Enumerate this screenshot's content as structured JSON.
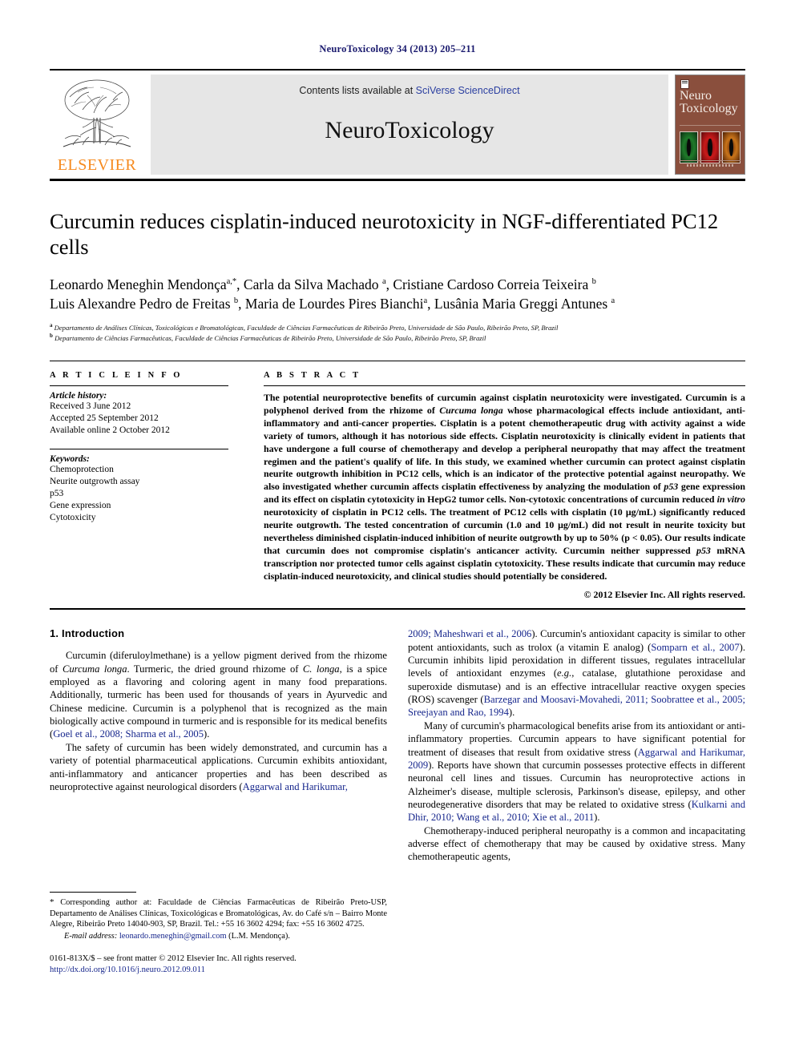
{
  "running_head": "NeuroToxicology 34 (2013) 205–211",
  "masthead": {
    "publisher_name": "ELSEVIER",
    "contents_prefix": "Contents lists available at ",
    "contents_link": "SciVerse ScienceDirect",
    "journal_name": "NeuroToxicology",
    "cover_title_line1": "Neuro",
    "cover_title_line2": "Toxicology"
  },
  "article": {
    "title": "Curcumin reduces cisplatin-induced neurotoxicity in NGF-differentiated PC12 cells",
    "authors_line1": "Leonardo Meneghin Mendonça",
    "authors_line1_sup": "a,*",
    "authors_line1b": ", Carla da Silva Machado ",
    "authors_line1b_sup": "a",
    "authors_line1c": ", Cristiane Cardoso Correia Teixeira ",
    "authors_line1c_sup": "b",
    "authors_line2": "Luis Alexandre Pedro de Freitas ",
    "authors_line2_sup": "b",
    "authors_line2b": ", Maria de Lourdes Pires Bianchi",
    "authors_line2b_sup": "a",
    "authors_line2c": ", Lusânia Maria Greggi Antunes ",
    "authors_line2c_sup": "a",
    "affiliation_a": "Departamento de Análises Clínicas, Toxicológicas e Bromatológicas, Faculdade de Ciências Farmacêuticas de Ribeirão Preto, Universidade de São Paulo, Ribeirão Preto, SP, Brazil",
    "affiliation_b": "Departamento de Ciências Farmacêuticas, Faculdade de Ciências Farmacêuticas de Ribeirão Preto, Universidade de São Paulo, Ribeirão Preto, SP, Brazil"
  },
  "article_info": {
    "label": "A R T I C L E  I N F O",
    "history_title": "Article history:",
    "received": "Received 3 June 2012",
    "accepted": "Accepted 25 September 2012",
    "available": "Available online 2 October 2012",
    "keywords_title": "Keywords:",
    "keywords": [
      "Chemoprotection",
      "Neurite outgrowth assay",
      "p53",
      "Gene expression",
      "Cytotoxicity"
    ]
  },
  "abstract": {
    "label": "A B S T R A C T",
    "part1": "The potential neuroprotective benefits of curcumin against cisplatin neurotoxicity were investigated. Curcumin is a polyphenol derived from the rhizome of ",
    "italic1": "Curcuma longa",
    "part2": " whose pharmacological effects include antioxidant, anti-inflammatory and anti-cancer properties. Cisplatin is a potent chemotherapeutic drug with activity against a wide variety of tumors, although it has notorious side effects. Cisplatin neurotoxicity is clinically evident in patients that have undergone a full course of chemotherapy and develop a peripheral neuropathy that may affect the treatment regimen and the patient's qualify of life. In this study, we examined whether curcumin can protect against cisplatin neurite outgrowth inhibition in PC12 cells, which is an indicator of the protective potential against neuropathy. We also investigated whether curcumin affects cisplatin effectiveness by analyzing the modulation of ",
    "italic2": "p53",
    "part3": " gene expression and its effect on cisplatin cytotoxicity in HepG2 tumor cells. Non-cytotoxic concentrations of curcumin reduced ",
    "italic3": "in vitro",
    "part4": " neurotoxicity of cisplatin in PC12 cells. The treatment of PC12 cells with cisplatin (10 μg/mL) significantly reduced neurite outgrowth. The tested concentration of curcumin (1.0 and 10 μg/mL) did not result in neurite toxicity but nevertheless diminished cisplatin-induced inhibition of neurite outgrowth by up to 50% (p < 0.05). Our results indicate that curcumin does not compromise cisplatin's anticancer activity. Curcumin neither suppressed ",
    "italic4": "p53",
    "part5": " mRNA transcription nor protected tumor cells against cisplatin cytotoxicity. These results indicate that curcumin may reduce cisplatin-induced neurotoxicity, and clinical studies should potentially be considered.",
    "copyright": "© 2012 Elsevier Inc. All rights reserved."
  },
  "introduction": {
    "heading": "1. Introduction",
    "left_p1_a": "Curcumin (diferuloylmethane) is a yellow pigment derived from the rhizome of ",
    "left_p1_i1": "Curcuma longa",
    "left_p1_b": ". Turmeric, the dried ground rhizome of ",
    "left_p1_i2": "C. longa",
    "left_p1_c": ", is a spice employed as a flavoring and coloring agent in many food preparations. Additionally, turmeric has been used for thousands of years in Ayurvedic and Chinese medicine. Curcumin is a polyphenol that is recognized as the main biologically active compound in turmeric and is responsible for its medical benefits (",
    "left_p1_cite": "Goel et al., 2008; Sharma et al., 2005",
    "left_p1_d": ").",
    "left_p2_a": "The safety of curcumin has been widely demonstrated, and curcumin has a variety of potential pharmaceutical applications. Curcumin exhibits antioxidant, anti-inflammatory and anticancer properties and has been described as neuroprotective against neurological disorders (",
    "left_p2_cite": "Aggarwal and Harikumar,",
    "right_p1_cite1": "2009; Maheshwari et al., 2006",
    "right_p1_a": "). Curcumin's antioxidant capacity is similar to other potent antioxidants, such as trolox (a vitamin E analog) (",
    "right_p1_cite2": "Somparn et al., 2007",
    "right_p1_b": "). Curcumin inhibits lipid peroxidation in different tissues, regulates intracellular levels of antioxidant enzymes (",
    "right_p1_i1": "e.g.",
    "right_p1_c": ", catalase, glutathione peroxidase and superoxide dismutase) and is an effective intracellular reactive oxygen species (ROS) scavenger (",
    "right_p1_cite3": "Barzegar and Moosavi-Movahedi, 2011; Soobrattee et al., 2005; Sreejayan and Rao, 1994",
    "right_p1_d": ").",
    "right_p2_a": "Many of curcumin's pharmacological benefits arise from its antioxidant or anti-inflammatory properties. Curcumin appears to have significant potential for treatment of diseases that result from oxidative stress (",
    "right_p2_cite1": "Aggarwal and Harikumar, 2009",
    "right_p2_b": "). Reports have shown that curcumin possesses protective effects in different neuronal cell lines and tissues. Curcumin has neuroprotective actions in Alzheimer's disease, multiple sclerosis, Parkinson's disease, epilepsy, and other neurodegenerative disorders that may be related to oxidative stress (",
    "right_p2_cite2": "Kulkarni and Dhir, 2010; Wang et al., 2010; Xie et al., 2011",
    "right_p2_c": ").",
    "right_p3": "Chemotherapy-induced peripheral neuropathy is a common and incapacitating adverse effect of chemotherapy that may be caused by oxidative stress. Many chemotherapeutic agents,"
  },
  "footnotes": {
    "corresponding_star": "*",
    "corresponding": " Corresponding author at: Faculdade de Ciências Farmacêuticas de Ribeirão Preto-USP, Departamento de Análises Clínicas, Toxicológicas e Bromatológicas, Av. do Café s/n – Bairro Monte Alegre, Ribeirão Preto 14040-903, SP, Brazil. Tel.: +55 16 3602 4294; fax: +55 16 3602 4725.",
    "email_label": "E-mail address:",
    "email": "leonardo.meneghin@gmail.com",
    "email_suffix": " (L.M. Mendonça).",
    "issn_line": "0161-813X/$ – see front matter © 2012 Elsevier Inc. All rights reserved.",
    "doi": "http://dx.doi.org/10.1016/j.neuro.2012.09.011"
  },
  "colors": {
    "elsevier_orange": "#F68A1E",
    "link_blue": "#16268c",
    "header_navy": "#1a1a6e",
    "banner_gray": "#e6e6e6",
    "cover_brown": "#8a4f3d"
  }
}
